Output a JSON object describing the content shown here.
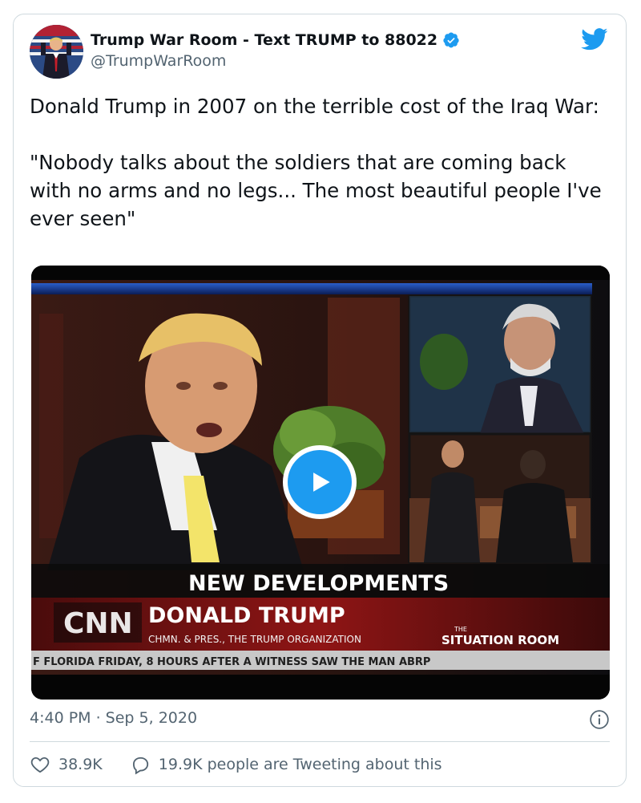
{
  "author": {
    "display_name": "Trump War Room - Text TRUMP to 88022",
    "handle": "@TrumpWarRoom",
    "verified": true
  },
  "tweet": {
    "text": "Donald Trump in 2007 on the terrible cost of the Iraq War:\n\n\"Nobody talks about the soldiers that are coming back with no arms and no legs... The most beautiful people I've ever seen\""
  },
  "video": {
    "lower_third_headline": "NEW DEVELOPMENTS",
    "network_logo": "CNN",
    "speaker_name": "DONALD TRUMP",
    "speaker_title": "CHMN. & PRES., THE TRUMP ORGANIZATION",
    "show_name_small": "THE",
    "show_name": "SITUATION ROOM",
    "ticker": "F FLORIDA FRIDAY, 8 HOURS AFTER A WITNESS SAW THE MAN ABRP"
  },
  "meta": {
    "timestamp": "4:40 PM · Sep 5, 2020"
  },
  "engagement": {
    "likes": "38.9K",
    "tweeting_about": "19.9K people are Tweeting about this"
  },
  "icons": {
    "brand": "twitter-bird-icon",
    "verified": "verified-badge-icon",
    "play": "play-icon",
    "info": "info-icon",
    "like": "heart-icon",
    "reply": "speech-bubble-icon"
  },
  "colors": {
    "twitter_blue": "#1d9bf0",
    "text_primary": "#0f1419",
    "text_secondary": "#536471",
    "border": "#cfd9de"
  }
}
